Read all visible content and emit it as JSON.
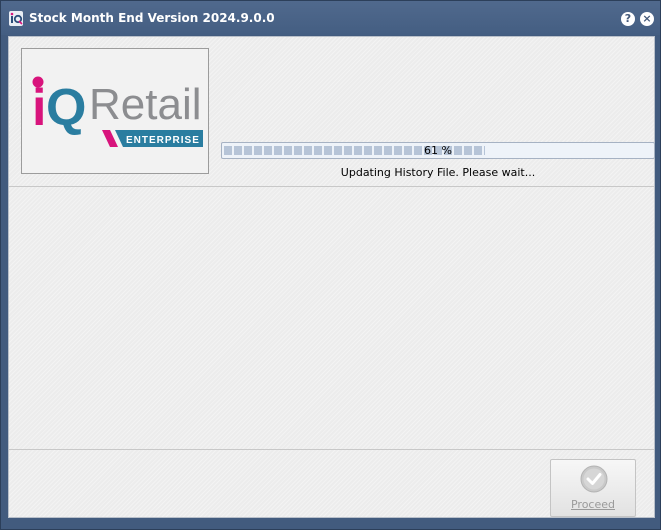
{
  "window": {
    "title": "Stock Month End Version 2024.9.0.0",
    "help_glyph": "?",
    "close_glyph": "×"
  },
  "logo": {
    "letter_i": "i",
    "letter_q": "Q",
    "word": "Retail",
    "tagline": "ENTERPRISE",
    "colors": {
      "magenta": "#d8147c",
      "teal": "#2a7da0",
      "gray": "#8c8d90"
    }
  },
  "progress": {
    "label": "61 %",
    "value_percent": 61
  },
  "status": {
    "message": "Updating History File.  Please wait..."
  },
  "footer": {
    "proceed_label": "Proceed",
    "proceed_enabled": false
  }
}
